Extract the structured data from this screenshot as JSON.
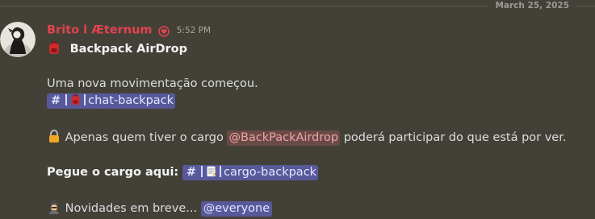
{
  "date_divider": "March 25, 2025",
  "author": {
    "name": "Brito l Æternum",
    "timestamp": "5:52 PM",
    "role_icon": "red-heart-sparkle-icon"
  },
  "message": {
    "title": "Backpack AirDrop",
    "title_emoji": "red-backpack-icon",
    "intro": "Uma nova movimentação começou.",
    "channel_1": {
      "hash": "#",
      "emoji": "red-backpack-icon",
      "name": "chat-backpack"
    },
    "lock_emoji": "lock-icon",
    "role_text_before": "Apenas quem tiver o cargo",
    "role_mention": "@BackPackAirdrop",
    "role_text_after": "poderá participar do que está por ver.",
    "cargo_label": "Pegue o cargo aqui:",
    "channel_2": {
      "hash": "#",
      "emoji": "memo-icon",
      "name": "cargo-backpack"
    },
    "spy_emoji": "detective-icon",
    "news_text": "Novidades em breve...",
    "everyone_mention": "@everyone"
  },
  "colors": {
    "background": "#434137",
    "author": "#e34250",
    "mention_bg": "#57599a",
    "role_mention_text": "#f0a4a4"
  }
}
